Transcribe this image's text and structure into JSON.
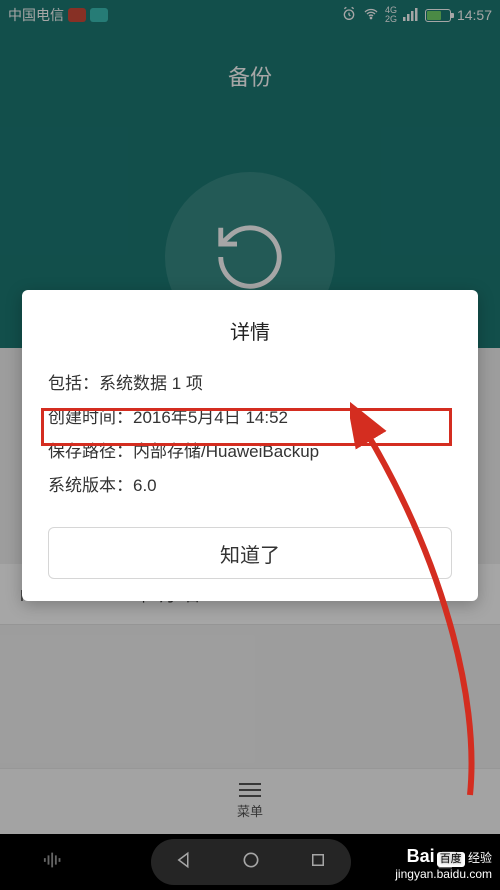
{
  "status": {
    "carrier": "中国电信",
    "network_top": "4G",
    "network_bot": "2G",
    "time": "14:57"
  },
  "header": {
    "title": "备份"
  },
  "list": {
    "item1": "NXT-AL10-2016年5月4日 14:52"
  },
  "dialog": {
    "title": "详情",
    "rows": {
      "includes_label": "包括：",
      "includes_value": "系统数据 1 项",
      "created_label": "创建时间：",
      "created_value": "2016年5月4日 14:52",
      "path_label": "保存路径：",
      "path_value": "内部存储/HuaweiBackup",
      "version_label": "系统版本：",
      "version_value": "6.0"
    },
    "ok_label": "知道了"
  },
  "bottom": {
    "menu_label": "菜单"
  },
  "watermark": {
    "brand": "Bai",
    "brand_badge": "百度",
    "suffix": "经验",
    "url": "jingyan.baidu.com"
  },
  "annotation": {
    "highlight_color": "#d42d20"
  }
}
